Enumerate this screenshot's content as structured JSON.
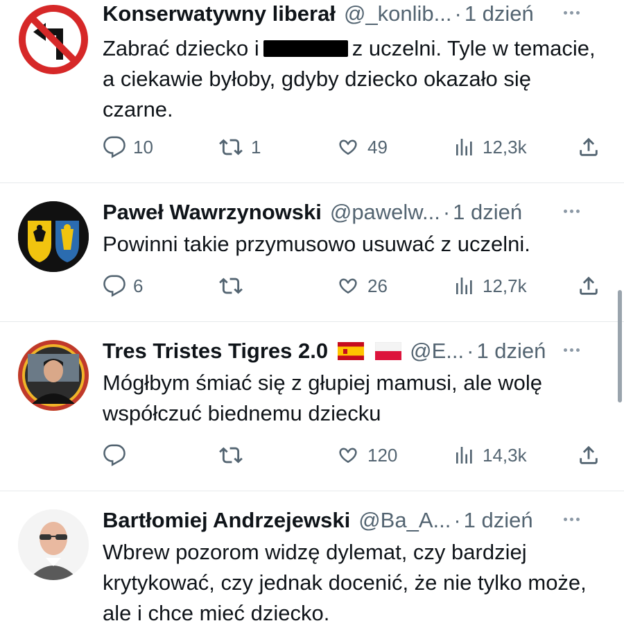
{
  "tweets": [
    {
      "name": "Konserwatywny liberał",
      "handle": "@_konlib...",
      "dot": "·",
      "time": "1 dzień",
      "text_before": "Zabrać dziecko i",
      "text_after": "z uczelni. Tyle w temacie, a ciekawie byłoby, gdyby dziecko okazało się czarne.",
      "stats": {
        "replies": "10",
        "retweets": "1",
        "likes": "49",
        "views": "12,3k"
      },
      "avatar": "no-left-turn-sign-icon"
    },
    {
      "name": "Paweł Wawrzynowski",
      "handle": "@pawelw...",
      "dot": "·",
      "time": "1 dzień",
      "text": "Powinni takie przymusowo usuwać z uczelni.",
      "stats": {
        "replies": "6",
        "retweets": "",
        "likes": "26",
        "views": "12,7k"
      },
      "avatar": "coat-of-arms-avatar"
    },
    {
      "name": "Tres Tristes Tigres 2.0",
      "handle": "@E...",
      "dot": "·",
      "time": "1 dzień",
      "text": "Mógłbym śmiać się z głupiej mamusi, ale wolę współczuć biednemu dziecku",
      "stats": {
        "replies": "",
        "retweets": "",
        "likes": "120",
        "views": "14,3k"
      },
      "flags": [
        "spain-flag-icon",
        "poland-flag-icon"
      ],
      "avatar": "man-portrait-avatar"
    },
    {
      "name": "Bartłomiej Andrzejewski",
      "handle": "@Ba_A...",
      "dot": "·",
      "time": "1 dzień",
      "text": "Wbrew pozorom widzę dylemat, czy bardziej krytykować, czy jednak docenić, że nie tylko może, ale i chce mieć dziecko.",
      "avatar": "bald-man-glasses-avatar"
    }
  ],
  "colors": {
    "text": "#0f1419",
    "secondary": "#536471",
    "divider": "#e6e9eb",
    "sign_red": "#d62828"
  }
}
